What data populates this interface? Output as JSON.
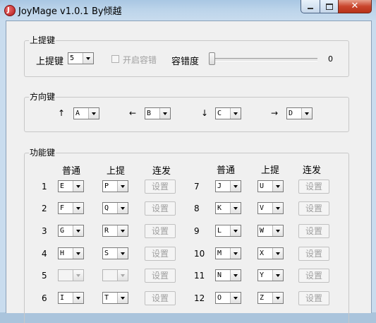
{
  "window": {
    "title": "JoyMage v1.0.1   By倾越",
    "icon_letter": "J",
    "min_icon": "minimize-icon",
    "max_icon": "maximize-icon",
    "close_icon": "close-icon",
    "close_glyph": "✕"
  },
  "lift": {
    "group_title": "上提键",
    "key_label": "上提键",
    "key_value": "5",
    "tolerance_toggle_label": "开启容错",
    "tolerance_label": "容错度",
    "tolerance_value": "0"
  },
  "direction": {
    "group_title": "方向键",
    "items": [
      {
        "arrow": "↑",
        "value": "A"
      },
      {
        "arrow": "←",
        "value": "B"
      },
      {
        "arrow": "↓",
        "value": "C"
      },
      {
        "arrow": "→",
        "value": "D"
      }
    ]
  },
  "function": {
    "group_title": "功能键",
    "headers": [
      "普通",
      "上提",
      "连发",
      "普通",
      "上提",
      "连发"
    ],
    "set_label": "设置",
    "left_rows": [
      {
        "num": "1",
        "normal": "E",
        "lift": "P",
        "disabled": false
      },
      {
        "num": "2",
        "normal": "F",
        "lift": "Q",
        "disabled": false
      },
      {
        "num": "3",
        "normal": "G",
        "lift": "R",
        "disabled": false
      },
      {
        "num": "4",
        "normal": "H",
        "lift": "S",
        "disabled": false
      },
      {
        "num": "5",
        "normal": "",
        "lift": "",
        "disabled": true
      },
      {
        "num": "6",
        "normal": "I",
        "lift": "T",
        "disabled": false
      }
    ],
    "right_rows": [
      {
        "num": "7",
        "normal": "J",
        "lift": "U",
        "disabled": false
      },
      {
        "num": "8",
        "normal": "K",
        "lift": "V",
        "disabled": false
      },
      {
        "num": "9",
        "normal": "L",
        "lift": "W",
        "disabled": false
      },
      {
        "num": "10",
        "normal": "M",
        "lift": "X",
        "disabled": false
      },
      {
        "num": "11",
        "normal": "N",
        "lift": "Y",
        "disabled": false
      },
      {
        "num": "12",
        "normal": "O",
        "lift": "Z",
        "disabled": false
      }
    ]
  }
}
